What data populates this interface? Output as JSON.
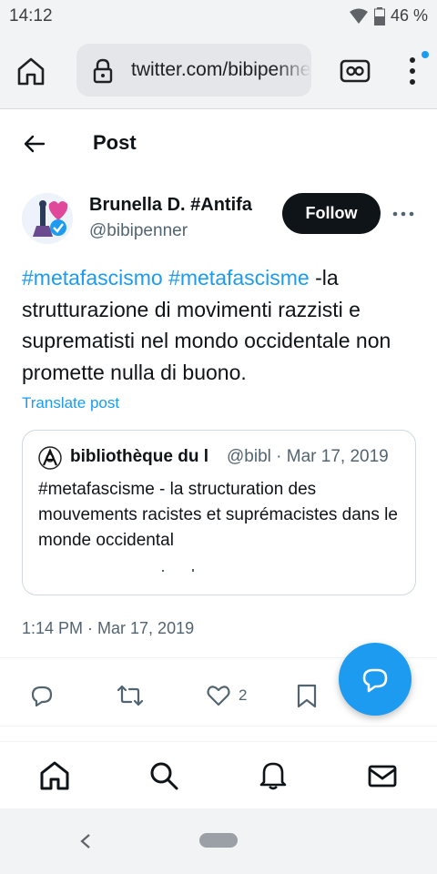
{
  "status_bar": {
    "time": "14:12",
    "battery_percent": "46 %",
    "icons": [
      "wifi-icon",
      "battery-icon"
    ]
  },
  "browser": {
    "url": "twitter.com/bibipenner",
    "icons": [
      "home-icon",
      "lock-icon",
      "tab-switcher-icon",
      "overflow-menu-icon"
    ],
    "menu_badge_color": "#1a9cf0"
  },
  "header": {
    "title": "Post"
  },
  "author": {
    "name": "Brunella D. #Antifa",
    "handle": "@bibipenner",
    "follow_label": "Follow"
  },
  "tweet": {
    "hashtag_1": "#metafascismo",
    "hashtag_2": "#metafascisme",
    "body": " -la strutturazione di movimenti razzisti e suprematisti nel mondo occidentale non promette nulla di buono.",
    "translate_label": "Translate post",
    "timestamp": "1:14 PM · Mar 17, 2019"
  },
  "quote": {
    "name": "bibliothèque du l",
    "handle_date": "@bibl · Mar 17, 2019",
    "text": "#metafascisme - la structuration des mouvements racistes et suprémacistes dans le monde occidental"
  },
  "actions": {
    "likes": "2"
  },
  "colors": {
    "accent": "#1d9bf0",
    "text": "#0f1419",
    "muted": "#536471"
  }
}
